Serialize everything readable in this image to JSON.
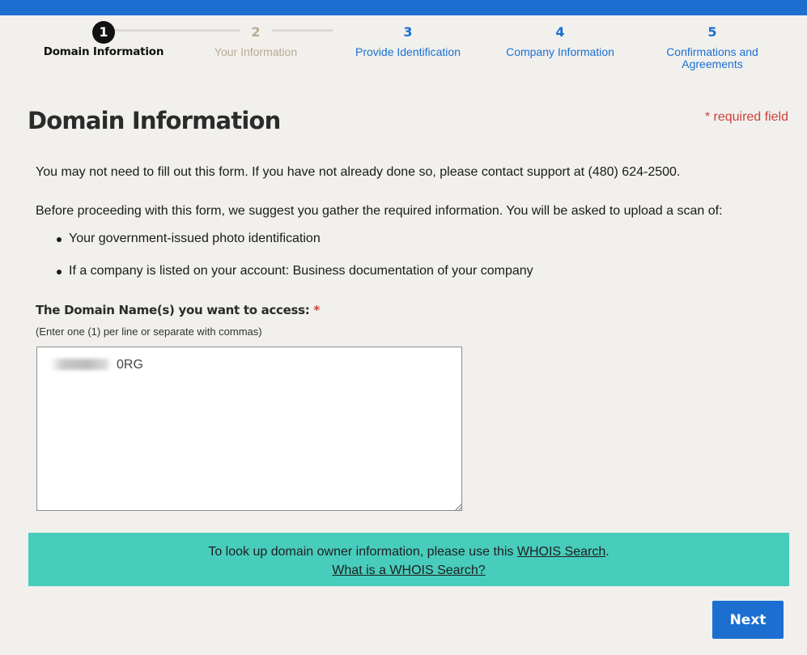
{
  "stepper": {
    "steps": [
      {
        "num": "1",
        "label": "Domain Information"
      },
      {
        "num": "2",
        "label": "Your Information"
      },
      {
        "num": "3",
        "label": "Provide Identification"
      },
      {
        "num": "4",
        "label": "Company Information"
      },
      {
        "num": "5",
        "label": "Confirmations and Agreements"
      }
    ],
    "active_step": 1
  },
  "header": {
    "title": "Domain Information",
    "required_note": "* required field"
  },
  "intro": {
    "line1": "You may not need to fill out this form. If you have not already done so, please contact support at (480) 624-2500.",
    "line2": "Before proceeding with this form, we suggest you gather the required information. You will be asked to upload a scan of:",
    "bullets": [
      "Your government-issued photo identification",
      "If a company is listed on your account: Business documentation of your company"
    ]
  },
  "domain_field": {
    "label": "The Domain Name(s) you want to access:",
    "required_mark": "*",
    "hint": "(Enter one (1) per line or separate with commas)",
    "value": "0RG"
  },
  "whois_banner": {
    "text_before": "To look up domain owner information, please use this ",
    "link1": "WHOIS Search",
    "text_after": ".",
    "link2": "What is a WHOIS Search?"
  },
  "actions": {
    "next_label": "Next"
  },
  "colors": {
    "brand_blue": "#1c6fd1",
    "required_red": "#d0413a",
    "banner_teal": "#48ccbc",
    "step_inactive": "#b7ab92"
  }
}
